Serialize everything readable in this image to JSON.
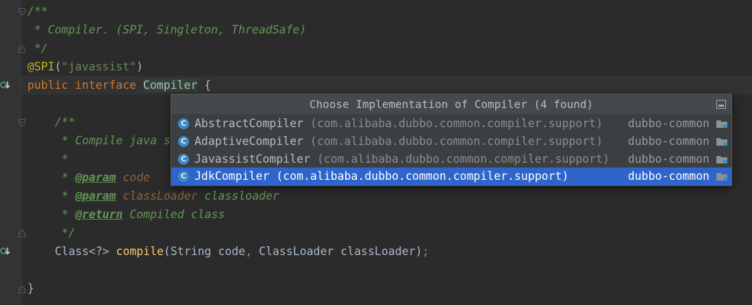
{
  "code_lines": {
    "l1": "/**",
    "l2": " * Compiler. (SPI, Singleton, ThreadSafe)",
    "l3": " */",
    "l4_ann": "@SPI",
    "l4_open": "(",
    "l4_str": "\"javassist\"",
    "l4_close": ")",
    "l5_kw": "public interface ",
    "l5_name": "Compiler",
    "l5_brace": " {",
    "l7": "/**",
    "l8": " * Compile java s",
    "l9": " *",
    "l10_star": " * ",
    "l10_tag": "@param",
    "l10_val": " code",
    "l11_star": " * ",
    "l11_tag": "@param",
    "l11_val": " classLoader",
    "l11_desc": " classloader",
    "l12_star": " * ",
    "l12_tag": "@return",
    "l12_desc": " Compiled class",
    "l13": " */",
    "l14_type": "Class<?> ",
    "l14_fn": "compile",
    "l14_p1": "(String code",
    "l14_comma": ", ",
    "l14_p2": "ClassLoader classLoader)",
    "l14_semi": ";",
    "l16": "}"
  },
  "popup": {
    "title": "Choose Implementation of Compiler (4 found)",
    "items": [
      {
        "icon_letter": "C",
        "name": "AbstractCompiler",
        "package": " (com.alibaba.dubbo.common.compiler.support)",
        "module": "dubbo-common"
      },
      {
        "icon_letter": "C",
        "name": "AdaptiveCompiler",
        "package": " (com.alibaba.dubbo.common.compiler.support)",
        "module": "dubbo-common"
      },
      {
        "icon_letter": "C",
        "name": "JavassistCompiler",
        "package": " (com.alibaba.dubbo.common.compiler.support)",
        "module": "dubbo-common"
      },
      {
        "icon_letter": "C",
        "name": "JdkCompiler",
        "package": " (com.alibaba.dubbo.common.compiler.support)",
        "module": "dubbo-common"
      }
    ],
    "selected_index": 3
  },
  "icons": {
    "gutter_impl": "implemented-gutter-icon",
    "fold": "fold-marker-icon",
    "pin": "pin-window-icon",
    "class": "class-icon",
    "module": "module-folder-icon"
  },
  "colors": {
    "background": "#2b2b2b",
    "selection": "#2f65ca",
    "keyword": "#cc7832",
    "doc_comment": "#629755",
    "string": "#6a8759",
    "annotation": "#bbb529",
    "method": "#ffc66d"
  }
}
